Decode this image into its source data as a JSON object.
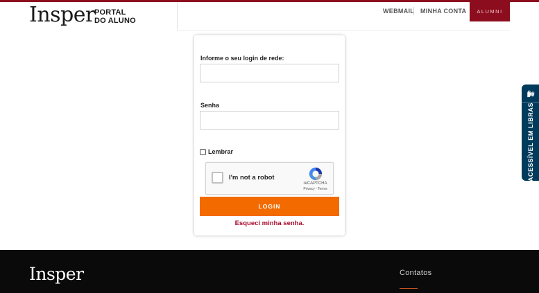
{
  "header": {
    "logo": "Insper",
    "portal_line1": "PORTAL",
    "portal_line2": "DO ALUNO",
    "nav": [
      "WEBMAIL",
      "MINHA CONTA"
    ],
    "alumni": "ALUMNI"
  },
  "form": {
    "login_label": "Informe o seu login de rede:",
    "login_value": "",
    "password_label": "Senha",
    "password_value": "",
    "remember_label": "Lembrar",
    "remember_checked": false,
    "login_button": "LOGIN",
    "forgot_link": "Esqueci minha senha."
  },
  "recaptcha": {
    "label": "I'm not a robot",
    "brand": "reCAPTCHA",
    "terms": "Privacy - Terms"
  },
  "accessibility": {
    "label": "ACESSÍVEL EM LIBRAS",
    "icon": "hands-sign-icon"
  },
  "footer": {
    "logo": "Insper",
    "contacts": "Contatos"
  },
  "colors": {
    "brand_red": "#8c0d1d",
    "login_orange": "#f26a00",
    "link_red": "#a6092b",
    "accessibility_blue": "#003b5c",
    "footer_black": "#0a0a0a"
  }
}
